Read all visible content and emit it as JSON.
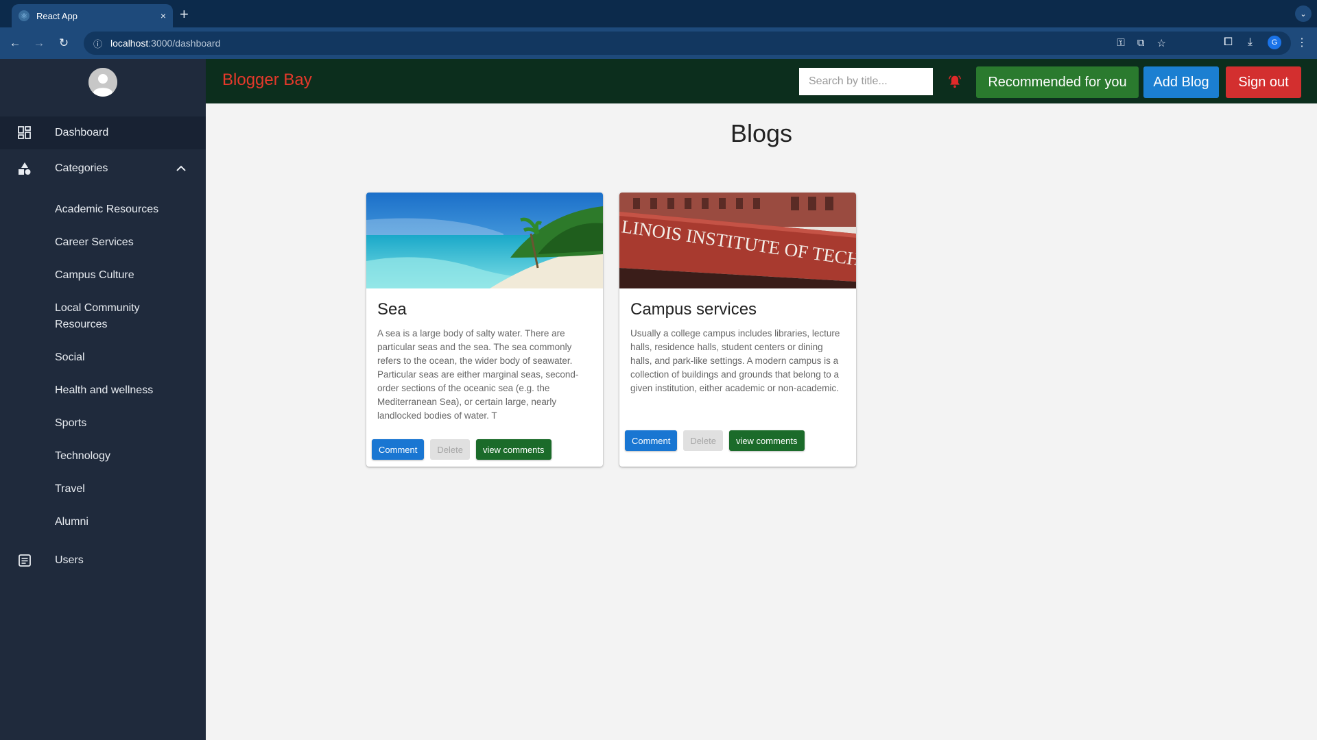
{
  "browser": {
    "tab_title": "React App",
    "tab_close": "×",
    "new_tab": "+",
    "url_host": "localhost",
    "url_path": ":3000/dashboard",
    "profile_initial": "G"
  },
  "sidebar": {
    "dashboard_label": "Dashboard",
    "categories_label": "Categories",
    "categories": [
      "Academic Resources",
      "Career Services",
      "Campus Culture",
      "Local Community Resources",
      "Social",
      "Health and wellness",
      "Sports",
      "Technology",
      "Travel",
      "Alumni"
    ],
    "users_label": "Users"
  },
  "appbar": {
    "brand": "Blogger Bay",
    "search_placeholder": "Search by title...",
    "recommended_label": "Recommended for you",
    "add_blog_label": "Add Blog",
    "sign_out_label": "Sign out"
  },
  "main": {
    "title": "Blogs",
    "cards": [
      {
        "title": "Sea",
        "description": "A sea is a large body of salty water. There are particular seas and the sea. The sea commonly refers to the ocean, the wider body of seawater. Particular seas are either marginal seas, second-order sections of the oceanic sea (e.g. the Mediterranean Sea), or certain large, nearly landlocked bodies of water. T",
        "image": "tropical-beach"
      },
      {
        "title": "Campus services",
        "description": "Usually a college campus includes libraries, lecture halls, residence halls, student centers or dining halls, and park-like settings. A modern campus is a collection of buildings and grounds that belong to a given institution, either academic or non-academic.",
        "image": "campus-building",
        "image_text": "LINOIS INSTITUTE OF TECHNOLOG"
      }
    ],
    "comment_label": "Comment",
    "delete_label": "Delete",
    "view_comments_label": "view comments"
  },
  "colors": {
    "sidebar_bg": "#1f2a3c",
    "appbar_bg": "#0c2e1d",
    "brand": "#e6392b",
    "recommended": "#2a7a2e",
    "add_blog": "#1b7fd1",
    "sign_out": "#d32f2f"
  }
}
